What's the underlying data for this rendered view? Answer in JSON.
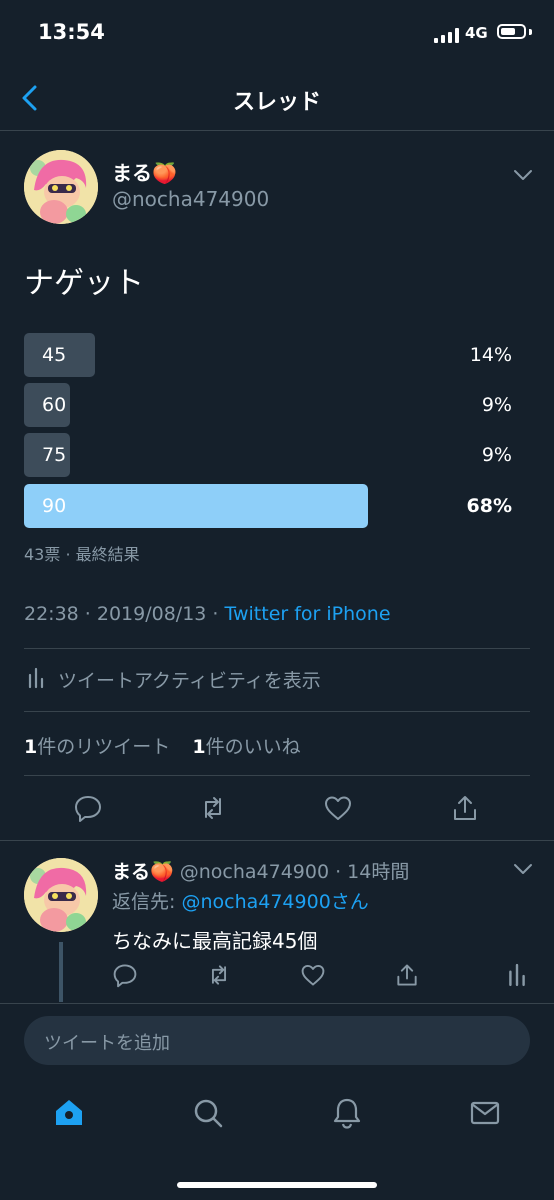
{
  "status_bar": {
    "time": "13:54",
    "network": "4G"
  },
  "nav": {
    "title": "スレッド"
  },
  "tweet": {
    "name": "まる🍑",
    "handle": "@nocha474900",
    "text": "ナゲット",
    "poll": {
      "options": [
        {
          "label": "45",
          "percent_text": "14%",
          "percent": 14,
          "winner": false
        },
        {
          "label": "60",
          "percent_text": "9%",
          "percent": 9,
          "winner": false
        },
        {
          "label": "75",
          "percent_text": "9%",
          "percent": 9,
          "winner": false
        },
        {
          "label": "90",
          "percent_text": "68%",
          "percent": 68,
          "winner": true
        }
      ],
      "summary": "43票 · 最終結果"
    },
    "timestamp": "22:38 · 2019/08/13 · ",
    "source": "Twitter for iPhone",
    "activity_label": "ツイートアクティビティを表示",
    "retweet_count": "1",
    "retweet_label": "件のリツイート",
    "like_count": "1",
    "like_label": "件のいいね"
  },
  "reply": {
    "name": "まる🍑",
    "meta": "@nocha474900 · 14時間",
    "reply_to_prefix": "返信先: ",
    "reply_to_handle": "@nocha474900さん",
    "text": "ちなみに最高記録45個"
  },
  "compose": {
    "placeholder": "ツイートを追加"
  },
  "colors": {
    "background": "#15202b",
    "accent": "#1da1f2",
    "muted": "#8899a6",
    "poll_winner": "#8ecff9"
  }
}
